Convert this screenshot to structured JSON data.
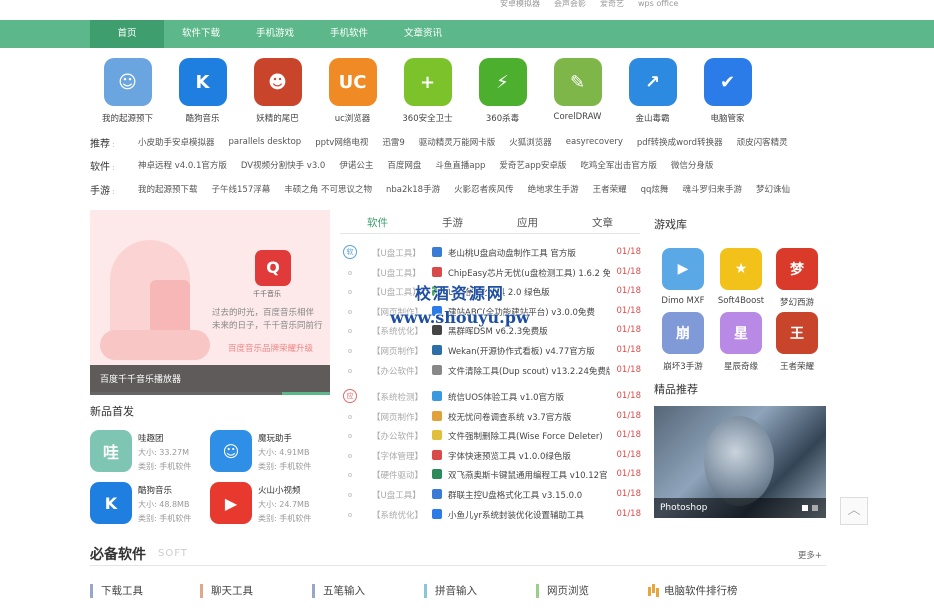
{
  "toplinks": [
    "安卓模拟器",
    "会声会影",
    "爱奇艺",
    "wps office"
  ],
  "nav": [
    "首页",
    "软件下载",
    "手机游戏",
    "手机软件",
    "文章资讯"
  ],
  "apps": [
    {
      "name": "我的起源预下",
      "color": "#6aa5e0",
      "glyph": "☺"
    },
    {
      "name": "酷狗音乐",
      "color": "#1e7fe0",
      "glyph": "K"
    },
    {
      "name": "妖精的尾巴",
      "color": "#c8452c",
      "glyph": "☻"
    },
    {
      "name": "uc浏览器",
      "color": "#f08a24",
      "glyph": "UC"
    },
    {
      "name": "360安全卫士",
      "color": "#7cc22b",
      "glyph": "+"
    },
    {
      "name": "360杀毒",
      "color": "#4caf2e",
      "glyph": "⚡"
    },
    {
      "name": "CorelDRAW",
      "color": "#7fb64a",
      "glyph": "✎"
    },
    {
      "name": "金山毒霸",
      "color": "#2c8ae0",
      "glyph": "↗"
    },
    {
      "name": "电脑管家",
      "color": "#2b7be8",
      "glyph": "✔"
    }
  ],
  "tagrows": [
    {
      "label": "推荐",
      "items": [
        "小皮助手安卓模拟器",
        "parallels desktop",
        "pptv网络电视",
        "迅雷9",
        "驱动精灵万能网卡版",
        "火狐浏览器",
        "easyrecovery",
        "pdf转换成word转换器",
        "顽皮闪客精灵"
      ]
    },
    {
      "label": "软件",
      "items": [
        "神卓远程 v4.0.1官方版",
        "DV视频分割快手 v3.0",
        "伊诺公主",
        "百度网盘",
        "斗鱼直播app",
        "爱奇艺app安卓版",
        "吃鸡全军出击官方版",
        "微信分身版"
      ]
    },
    {
      "label": "手游",
      "items": [
        "我的起源预下载",
        "子午线157浮幕",
        "丰硕之角 不可思议之物",
        "nba2k18手游",
        "火影忍者疾风传",
        "绝地求生手游",
        "王者荣耀",
        "qq炫舞",
        "魂斗罗归来手游",
        "梦幻诛仙"
      ]
    }
  ],
  "banner": {
    "caption": "百度千千音乐播放器",
    "line1": "过去的时光，百度音乐相伴",
    "line2": "未来的日子，千千音乐同前行",
    "line3": "百度音乐品牌荣耀升级",
    "logo_text": "千千音乐",
    "logo_glyph": "Q"
  },
  "new_title": "新品首发",
  "new_apps": [
    {
      "name": "哇趣团",
      "size": "大小: 33.27M",
      "cat": "类别: 手机软件",
      "color": "#7ec5b4",
      "glyph": "哇"
    },
    {
      "name": "魔玩助手",
      "size": "大小: 4.91MB",
      "cat": "类别: 手机软件",
      "color": "#2f8fe6",
      "glyph": "☺"
    },
    {
      "name": "酷狗音乐",
      "size": "大小: 48.8MB",
      "cat": "类别: 手机软件",
      "color": "#1e7fe0",
      "glyph": "K"
    },
    {
      "name": "火山小视频",
      "size": "大小: 24.7MB",
      "cat": "类别: 手机软件",
      "color": "#e8392e",
      "glyph": "▶"
    }
  ],
  "tabs": [
    "软件",
    "手游",
    "应用",
    "文章"
  ],
  "soft_list": [
    {
      "cat": "【U盘工具】",
      "title": "老山桃U盘启动盘制作工具 官方版",
      "date": "01/18",
      "color": "#3a7bd5"
    },
    {
      "cat": "【U盘工具】",
      "title": "ChipEasy芯片无忧(u盘检测工具) 1.6.2 免",
      "date": "01/18",
      "color": "#d94b4b"
    },
    {
      "cat": "【U盘工具】",
      "title": "U盘格式化工具 2.0 绿色版",
      "date": "01/18",
      "color": "#4caf50"
    },
    {
      "cat": "【网页制作】",
      "title": "建站ABC(全功能建站平台) v3.0.0免费",
      "date": "01/18",
      "color": "#2b7be8"
    },
    {
      "cat": "【系统优化】",
      "title": "黑群晖DSM v6.2.3免费版",
      "date": "01/18",
      "color": "#444"
    },
    {
      "cat": "【网页制作】",
      "title": "Wekan(开源协作式看板) v4.77官方版",
      "date": "01/18",
      "color": "#2c6fa8"
    },
    {
      "cat": "【办公软件】",
      "title": "文件清除工具(Dup scout) v13.2.24免费版",
      "date": "01/18",
      "color": "#888"
    }
  ],
  "app_list": [
    {
      "cat": "【系统检测】",
      "title": "统信UOS体验工具 v1.0官方版",
      "date": "01/18",
      "color": "#3a9ae0"
    },
    {
      "cat": "【网页制作】",
      "title": "校无忧问卷调查系统 v3.7官方版",
      "date": "01/18",
      "color": "#e0a03a"
    },
    {
      "cat": "【办公软件】",
      "title": "文件强制删除工具(Wise Force Deleter)",
      "date": "01/18",
      "color": "#e0c03a"
    },
    {
      "cat": "【字体管理】",
      "title": "字体快速预览工具 v1.0.0绿色版",
      "date": "01/18",
      "color": "#d94b4b"
    },
    {
      "cat": "【硬件驱动】",
      "title": "双飞燕奥斯卡键鼠通用编程工具 v10.12官",
      "date": "01/18",
      "color": "#2c8a5a"
    },
    {
      "cat": "【U盘工具】",
      "title": "群联主控U盘格式化工具 v3.15.0.0",
      "date": "01/18",
      "color": "#3a7bd5"
    },
    {
      "cat": "【系统优化】",
      "title": "小鱼儿yr系统封装优化设置辅助工具",
      "date": "01/18",
      "color": "#2b7be8"
    }
  ],
  "list_icons": {
    "soft": "软",
    "app": "应"
  },
  "games_title": "游戏库",
  "games": [
    {
      "name": "Dimo MXF",
      "color": "#5aa8e6",
      "glyph": "▶"
    },
    {
      "name": "Soft4Boost",
      "color": "#f2c21b",
      "glyph": "★"
    },
    {
      "name": "梦幻西游",
      "color": "#d93a2a",
      "glyph": "梦"
    },
    {
      "name": "崩坏3手游",
      "color": "#7f9ad6",
      "glyph": "崩"
    },
    {
      "name": "星辰奇缘",
      "color": "#b88ae6",
      "glyph": "星"
    },
    {
      "name": "王者荣耀",
      "color": "#c8452c",
      "glyph": "王"
    }
  ],
  "featured_title": "精品推荐",
  "featured_caption": "Photoshop",
  "totop_glyph": "︿",
  "soft_head": {
    "title": "必备软件",
    "sub": "SOFT",
    "more": "更多+"
  },
  "soft_cats": [
    {
      "label": "下载工具",
      "color": "#9aa6c9"
    },
    {
      "label": "聊天工具",
      "color": "#e0a88a"
    },
    {
      "label": "五笔输入",
      "color": "#9aa6c9"
    },
    {
      "label": "拼音输入",
      "color": "#8ac5d9"
    },
    {
      "label": "网页浏览",
      "color": "#9acf8a"
    }
  ],
  "rank_label": "电脑软件排行榜",
  "watermark": {
    "line1": "校酒资源网",
    "line2": "www.shouyu.pw"
  }
}
